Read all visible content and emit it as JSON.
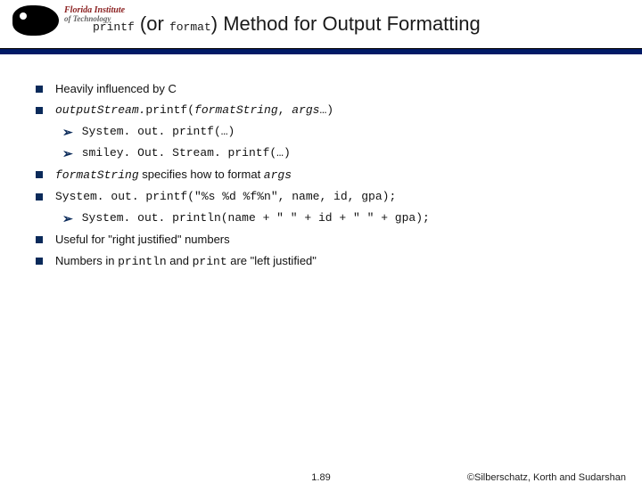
{
  "logo": {
    "line1": "Florida Institute",
    "line2": "of Technology"
  },
  "title": {
    "code1": "printf",
    "mid": " (or ",
    "code2": "format",
    "rest": ") Method for Output Formatting"
  },
  "bullets": {
    "b0": "Heavily influenced by C",
    "b1": {
      "pre": "outputStream.",
      "fn": "printf(",
      "arg1": "formatString",
      "mid": ", ",
      "arg2": "args",
      "end": "…)"
    },
    "b1s0": "System. out. printf(…)",
    "b1s1": "smiley. Out. Stream. printf(…)",
    "b2": {
      "c": "formatString",
      "mid": " specifies how to format ",
      "a": "args"
    },
    "b3": "System. out. printf(\"%s %d %f%n\", name, id, gpa);",
    "b3s0": "System. out. println(name + \"  \" + id + \"  \" + gpa);",
    "b4": "Useful for \"right justified\" numbers",
    "b5": {
      "pre": "Numbers in ",
      "c1": "println",
      "mid": " and ",
      "c2": "print",
      "post": " are \"left justified\""
    }
  },
  "footer": {
    "page": "1.89",
    "copyright": "©Silberschatz, Korth and Sudarshan"
  }
}
